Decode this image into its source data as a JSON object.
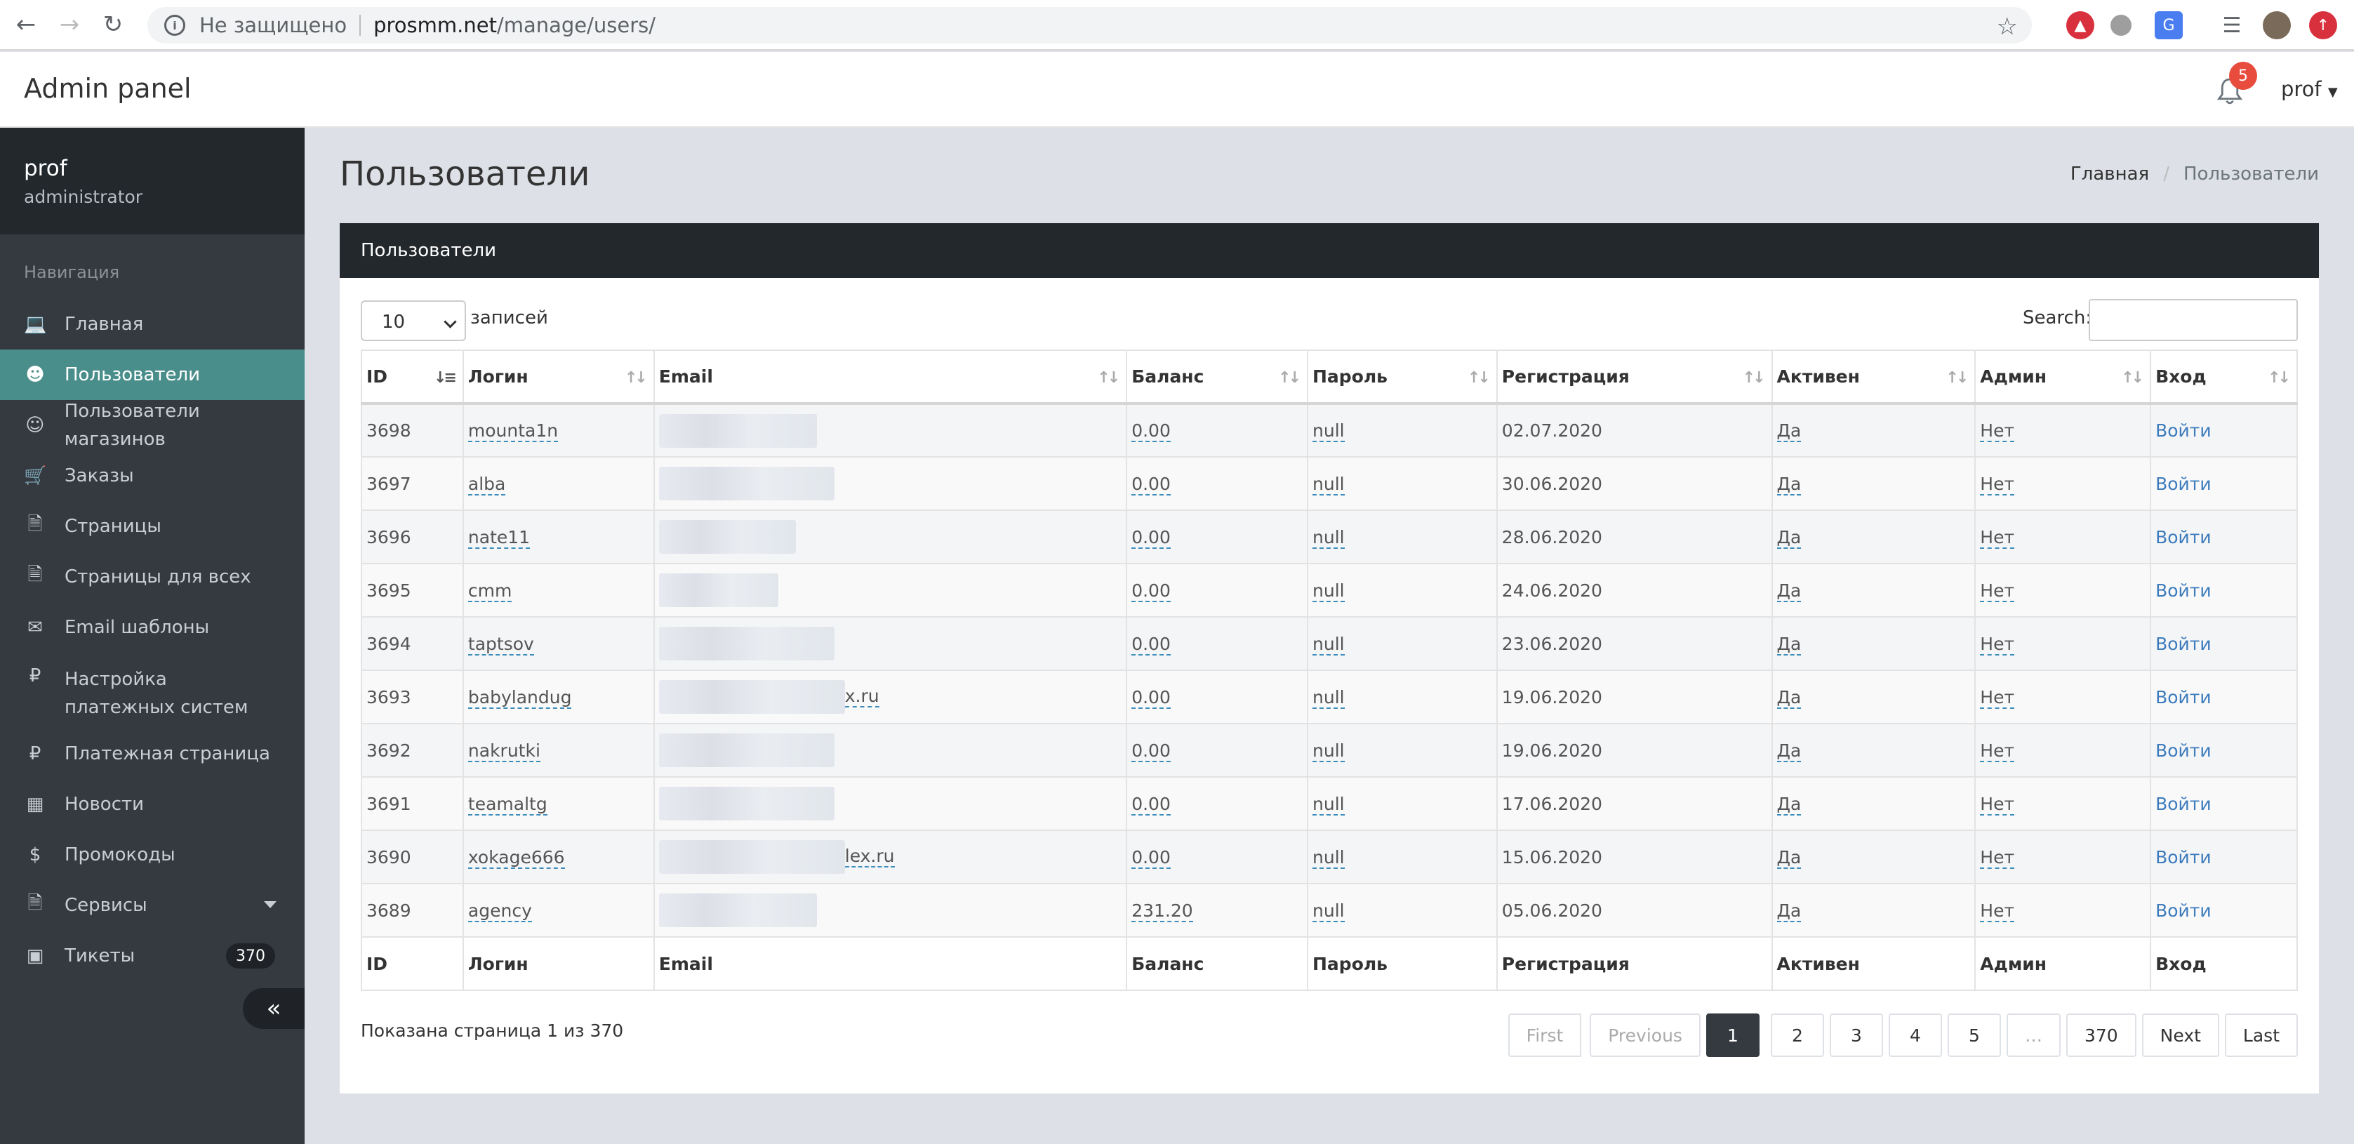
{
  "browser": {
    "insecure_label": "Не защищено",
    "url_host": "prosmm.net",
    "url_path": "/manage/users/"
  },
  "header": {
    "title": "Admin panel",
    "notifications_count": "5",
    "user_menu_label": "prof"
  },
  "sidebar": {
    "user_name": "prof",
    "user_role": "administrator",
    "nav_title": "Навигация",
    "items": [
      {
        "label": "Главная",
        "icon": "laptop-icon"
      },
      {
        "label": "Пользователи",
        "icon": "users-icon"
      },
      {
        "label": "Пользователи магазинов",
        "icon": "user-add-icon"
      },
      {
        "label": "Заказы",
        "icon": "cart-icon"
      },
      {
        "label": "Страницы",
        "icon": "file-icon"
      },
      {
        "label": "Страницы для всех",
        "icon": "file-icon"
      },
      {
        "label": "Email шаблоны",
        "icon": "envelope-icon"
      },
      {
        "label": "Настройка платежных систем",
        "icon": "ruble-icon"
      },
      {
        "label": "Платежная страница",
        "icon": "ruble-icon"
      },
      {
        "label": "Новости",
        "icon": "newspaper-icon"
      },
      {
        "label": "Промокоды",
        "icon": "dollar-icon"
      },
      {
        "label": "Сервисы",
        "icon": "file-icon"
      },
      {
        "label": "Тикеты",
        "icon": "ticket-icon",
        "badge": "370"
      }
    ],
    "collapse_glyph": "«"
  },
  "content": {
    "page_title": "Пользователи",
    "breadcrumb_home": "Главная",
    "breadcrumb_sep": "/",
    "breadcrumb_current": "Пользователи",
    "card_title": "Пользователи",
    "length_value": "10",
    "length_label": "записей",
    "search_label": "Search:"
  },
  "table": {
    "columns": [
      "ID",
      "Логин",
      "Email",
      "Баланс",
      "Пароль",
      "Регистрация",
      "Активен",
      "Админ",
      "Вход"
    ],
    "rows": [
      {
        "id": "3698",
        "login": "mounta1n",
        "email_suffix": "",
        "balance": "0.00",
        "password": "null",
        "registered": "02.07.2020",
        "active": "Да",
        "admin": "Нет",
        "action": "Войти"
      },
      {
        "id": "3697",
        "login": "alba",
        "email_suffix": "",
        "balance": "0.00",
        "password": "null",
        "registered": "30.06.2020",
        "active": "Да",
        "admin": "Нет",
        "action": "Войти"
      },
      {
        "id": "3696",
        "login": "nate11",
        "email_suffix": "",
        "balance": "0.00",
        "password": "null",
        "registered": "28.06.2020",
        "active": "Да",
        "admin": "Нет",
        "action": "Войти"
      },
      {
        "id": "3695",
        "login": "cmm",
        "email_suffix": "",
        "balance": "0.00",
        "password": "null",
        "registered": "24.06.2020",
        "active": "Да",
        "admin": "Нет",
        "action": "Войти"
      },
      {
        "id": "3694",
        "login": "taptsov",
        "email_suffix": "",
        "balance": "0.00",
        "password": "null",
        "registered": "23.06.2020",
        "active": "Да",
        "admin": "Нет",
        "action": "Войти"
      },
      {
        "id": "3693",
        "login": "babylandug",
        "email_suffix": "x.ru",
        "balance": "0.00",
        "password": "null",
        "registered": "19.06.2020",
        "active": "Да",
        "admin": "Нет",
        "action": "Войти"
      },
      {
        "id": "3692",
        "login": "nakrutki",
        "email_suffix": "",
        "balance": "0.00",
        "password": "null",
        "registered": "19.06.2020",
        "active": "Да",
        "admin": "Нет",
        "action": "Войти"
      },
      {
        "id": "3691",
        "login": "teamaltg",
        "email_suffix": "",
        "balance": "0.00",
        "password": "null",
        "registered": "17.06.2020",
        "active": "Да",
        "admin": "Нет",
        "action": "Войти"
      },
      {
        "id": "3690",
        "login": "xokage666",
        "email_suffix": "lex.ru",
        "balance": "0.00",
        "password": "null",
        "registered": "15.06.2020",
        "active": "Да",
        "admin": "Нет",
        "action": "Войти"
      },
      {
        "id": "3689",
        "login": "agency",
        "email_suffix": "",
        "balance": "231.20",
        "password": "null",
        "registered": "05.06.2020",
        "active": "Да",
        "admin": "Нет",
        "action": "Войти"
      }
    ]
  },
  "footer": {
    "page_info": "Показана страница 1 из 370",
    "pager": {
      "first": "First",
      "previous": "Previous",
      "pages": [
        "1",
        "2",
        "3",
        "4",
        "5"
      ],
      "ellipsis": "…",
      "last_page": "370",
      "next": "Next",
      "last": "Last"
    }
  }
}
